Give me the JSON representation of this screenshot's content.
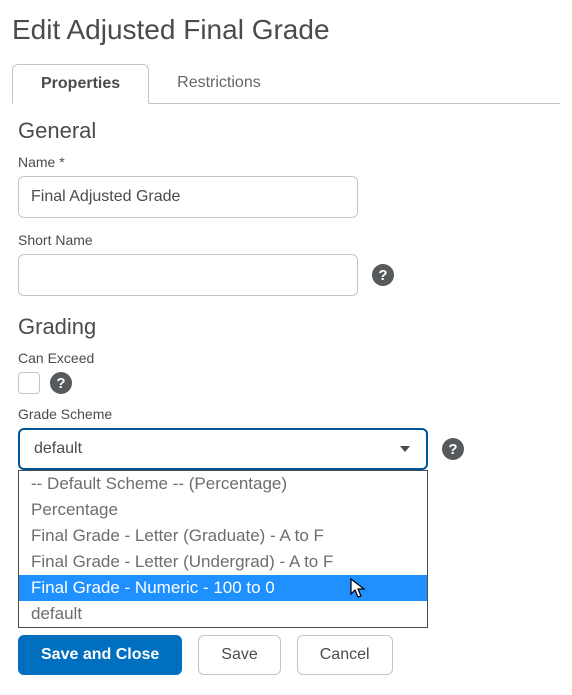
{
  "page_title": "Edit Adjusted Final Grade",
  "tabs": {
    "properties": "Properties",
    "restrictions": "Restrictions",
    "active": "properties"
  },
  "sections": {
    "general": {
      "heading": "General",
      "name_label": "Name *",
      "name_value": "Final Adjusted Grade",
      "short_name_label": "Short Name",
      "short_name_value": ""
    },
    "grading": {
      "heading": "Grading",
      "can_exceed_label": "Can Exceed",
      "can_exceed_checked": false,
      "grade_scheme_label": "Grade Scheme",
      "grade_scheme_selected": "default",
      "grade_scheme_options": [
        "-- Default Scheme -- (Percentage)",
        "Percentage",
        "Final Grade - Letter (Graduate) - A to F",
        "Final Grade - Letter (Undergrad) - A to F",
        "Final Grade - Numeric - 100 to 0",
        "default"
      ],
      "grade_scheme_highlight_index": 4
    }
  },
  "buttons": {
    "save_and_close": "Save and Close",
    "save": "Save",
    "cancel": "Cancel"
  },
  "icons": {
    "help": "?"
  }
}
